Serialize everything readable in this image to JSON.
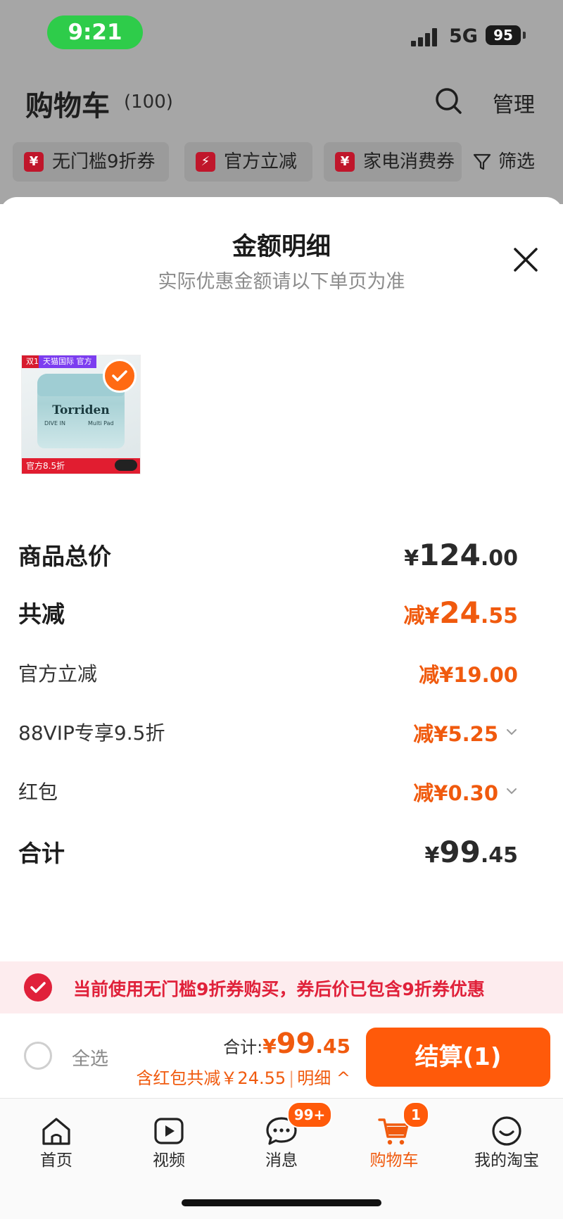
{
  "status_bar": {
    "time": "9:21",
    "network": "5G",
    "battery": "95"
  },
  "cart_header": {
    "title": "购物车",
    "count": "(100)",
    "manage": "管理"
  },
  "chips": [
    {
      "icon_text": "¥",
      "label": "无门槛9折券"
    },
    {
      "icon_text": "⚡",
      "label": "官方立减"
    },
    {
      "icon_text": "¥",
      "label": "家电消费券"
    }
  ],
  "filter_label": "筛选",
  "sheet": {
    "title": "金额明细",
    "subtitle": "实际优惠金额请以下单页为准"
  },
  "product": {
    "tag_left": "双11",
    "tag_right": "天猫国际 官方",
    "brand": "Torriden",
    "sub_left": "DIVE IN",
    "sub_right": "Multi Pad",
    "bottom_tag": "官方8.5折"
  },
  "rows": {
    "total": {
      "label": "商品总价",
      "yen": "¥",
      "int": "124",
      "dec": ".00"
    },
    "reduce": {
      "label": "共减",
      "prefix": "减¥",
      "int": "24",
      "dec": ".55"
    },
    "official": {
      "label": "官方立减",
      "value": "减¥19.00"
    },
    "vip": {
      "label": "88VIP专享9.5折",
      "value": "减¥5.25"
    },
    "redpacket": {
      "label": "红包",
      "value": "减¥0.30"
    },
    "sum": {
      "label": "合计",
      "yen": "¥",
      "int": "99",
      "dec": ".45"
    }
  },
  "notice": {
    "text": "当前使用无门槛9折券购买，券后价已包含9折券优惠"
  },
  "checkout": {
    "select_all": "全选",
    "total_prefix": "合计:",
    "total_yen": "¥",
    "total_int": "99",
    "total_dec": ".45",
    "discount_text": "含红包共减￥24.55",
    "separator": "|",
    "detail_link": "明细 ^",
    "settle_button": "结算(1)"
  },
  "tabbar": [
    {
      "label": "首页",
      "icon": "home-icon"
    },
    {
      "label": "视频",
      "icon": "video-icon"
    },
    {
      "label": "消息",
      "icon": "message-icon",
      "badge": "99+"
    },
    {
      "label": "购物车",
      "icon": "cart-icon",
      "badge": "1",
      "active": true
    },
    {
      "label": "我的淘宝",
      "icon": "profile-icon"
    }
  ],
  "colors": {
    "accent": "#f05a0e",
    "danger": "#e0213a",
    "status_green": "#2ecc4a"
  }
}
